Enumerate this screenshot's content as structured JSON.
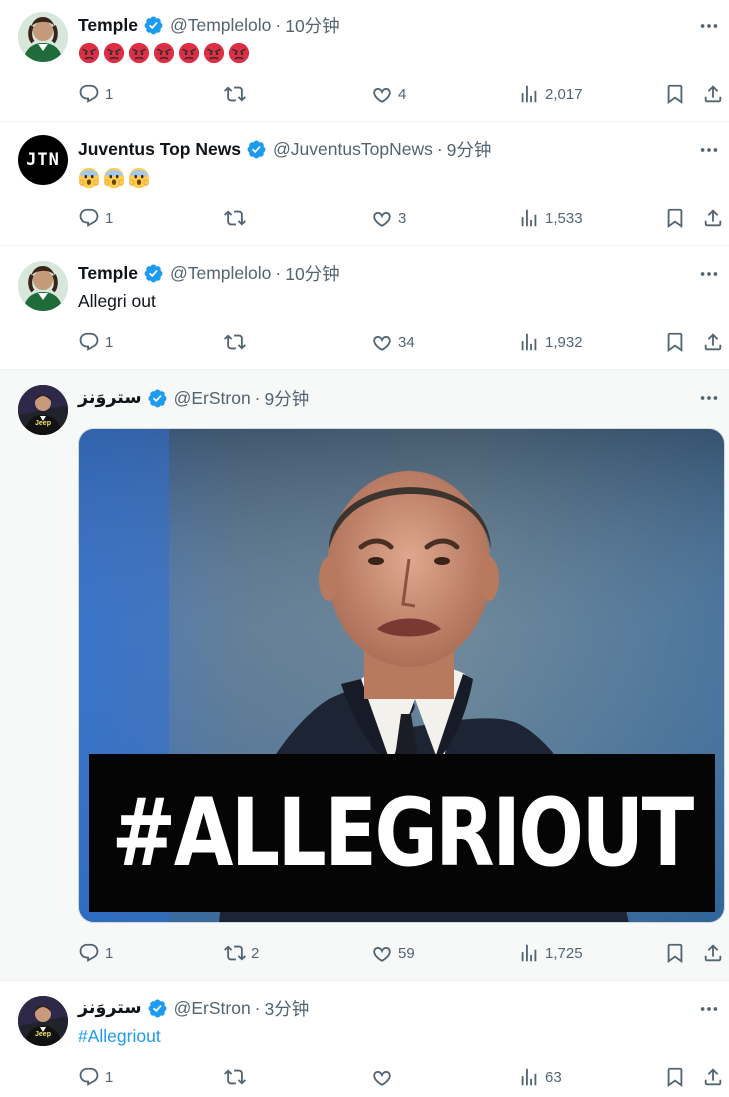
{
  "tweets": [
    {
      "name": "Temple",
      "handle": "@Templelolo",
      "time": "10分钟",
      "emoji_reaction": "angry-face-x7",
      "stats": {
        "replies": "1",
        "retweets": "",
        "likes": "4",
        "views": "2,017"
      }
    },
    {
      "name": "Juventus Top News",
      "handle": "@JuventusTopNews",
      "time": "9分钟",
      "avatar_text": "JTN",
      "emoji_reaction": "face-screaming-x3",
      "stats": {
        "replies": "1",
        "retweets": "",
        "likes": "3",
        "views": "1,533"
      }
    },
    {
      "name": "Temple",
      "handle": "@Templelolo",
      "time": "10分钟",
      "text": "Allegri out",
      "stats": {
        "replies": "1",
        "retweets": "",
        "likes": "34",
        "views": "1,932"
      }
    },
    {
      "name": "ستروَنز",
      "handle": "@ErStron",
      "time": "9分钟",
      "media_caption": "#ALLEGRIOUT",
      "stats": {
        "replies": "1",
        "retweets": "2",
        "likes": "59",
        "views": "1,725"
      }
    },
    {
      "name": "ستروَنز",
      "handle": "@ErStron",
      "time": "3分钟",
      "text": "#Allegriout",
      "stats": {
        "replies": "1",
        "retweets": "",
        "likes": "",
        "views": "63"
      }
    }
  ],
  "colors": {
    "verified": "#1d9bf0",
    "link": "#1d9bf0",
    "secondary": "#536471",
    "text": "#0f1419",
    "highlight_bg": "#f7f9f9"
  },
  "separator_dot": "·",
  "avatar_jersey_text": "Jeep"
}
